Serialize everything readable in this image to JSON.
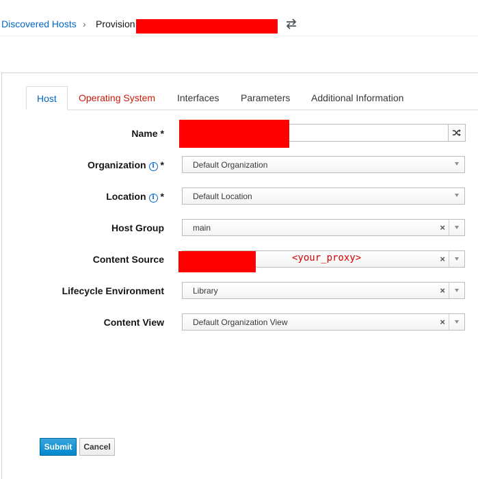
{
  "breadcrumb": {
    "parent": "Discovered Hosts",
    "separator": "›",
    "current": "Provision"
  },
  "tabs": [
    {
      "label": "Host",
      "state": "active"
    },
    {
      "label": "Operating System",
      "state": "error"
    },
    {
      "label": "Interfaces",
      "state": "normal"
    },
    {
      "label": "Parameters",
      "state": "normal"
    },
    {
      "label": "Additional Information",
      "state": "normal"
    }
  ],
  "form": {
    "name": {
      "label": "Name",
      "required": "*",
      "value": ""
    },
    "organization": {
      "label": "Organization",
      "required": "*",
      "value": "Default Organization"
    },
    "location": {
      "label": "Location",
      "required": "*",
      "value": "Default Location"
    },
    "host_group": {
      "label": "Host Group",
      "value": "main"
    },
    "content_source": {
      "label": "Content Source",
      "value": "",
      "annotation": "<your_proxy>"
    },
    "lifecycle_environment": {
      "label": "Lifecycle Environment",
      "value": "Library"
    },
    "content_view": {
      "label": "Content View",
      "value": "Default Organization View"
    }
  },
  "buttons": {
    "submit": "Submit",
    "cancel": "Cancel"
  },
  "icons": {
    "switch": "switch-arrows-icon",
    "random": "shuffle-icon",
    "info": "info-icon",
    "clear": "clear-x-icon"
  },
  "colors": {
    "link": "#0066cc",
    "error_tab": "#c9190b",
    "primary_button": "#0088ce",
    "redaction": "#ff0000"
  }
}
